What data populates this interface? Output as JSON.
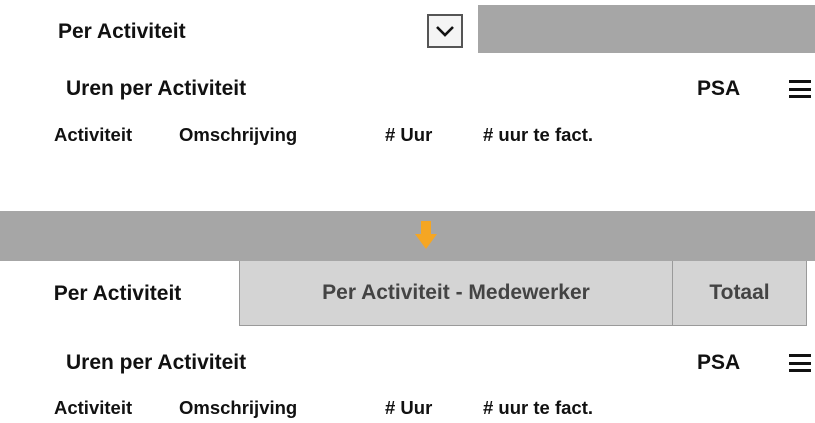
{
  "top": {
    "selected_view": "Per Activiteit",
    "panel": {
      "title": "Uren per Activiteit",
      "psa_label": "PSA",
      "columns": [
        "Activiteit",
        "Omschrijving",
        "# Uur",
        "# uur te fact."
      ]
    }
  },
  "divider": {
    "arrow_color": "#f5a623"
  },
  "tabs": [
    {
      "label": "Per Activiteit",
      "active": true
    },
    {
      "label": "Per Activiteit - Medewerker",
      "active": false
    },
    {
      "label": "Totaal",
      "active": false
    }
  ],
  "bottom": {
    "panel": {
      "title": "Uren per Activiteit",
      "psa_label": "PSA",
      "columns": [
        "Activiteit",
        "Omschrijving",
        "# Uur",
        "# uur te fact."
      ]
    }
  }
}
